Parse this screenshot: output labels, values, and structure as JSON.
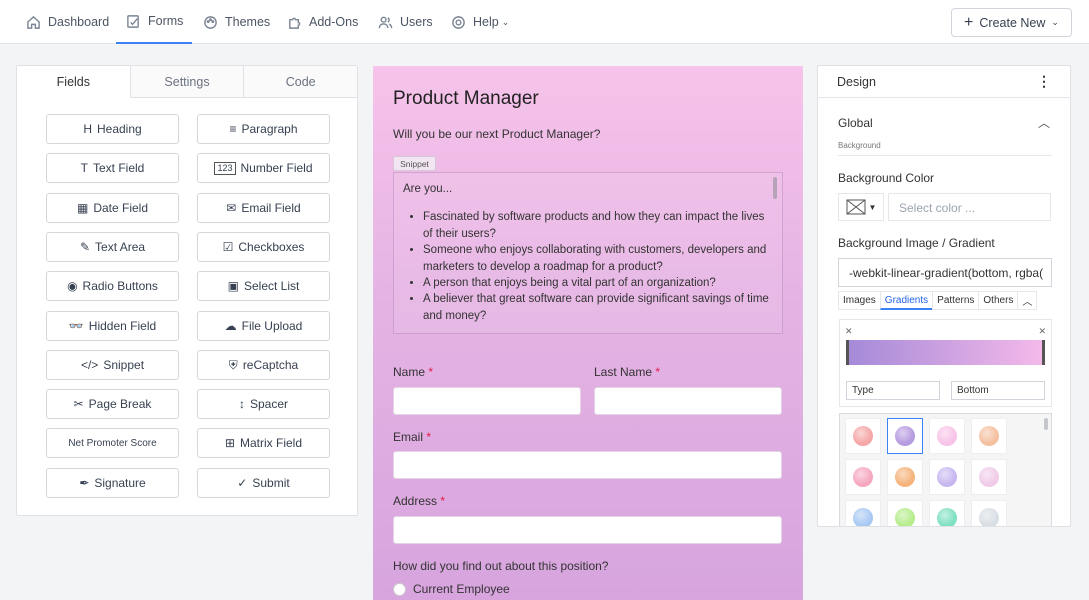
{
  "nav": {
    "items": [
      {
        "label": "Dashboard",
        "icon": "home-icon"
      },
      {
        "label": "Forms",
        "icon": "forms-icon"
      },
      {
        "label": "Themes",
        "icon": "palette-icon"
      },
      {
        "label": "Add-Ons",
        "icon": "puzzle-icon"
      },
      {
        "label": "Users",
        "icon": "users-icon"
      },
      {
        "label": "Help",
        "icon": "help-icon"
      }
    ],
    "create_label": "Create New"
  },
  "fields_panel": {
    "tabs": [
      "Fields",
      "Settings",
      "Code"
    ],
    "buttons": [
      {
        "label": "Heading",
        "icon": "H"
      },
      {
        "label": "Paragraph",
        "icon": "≡"
      },
      {
        "label": "Text Field",
        "icon": "T"
      },
      {
        "label": "Number Field",
        "icon": "123"
      },
      {
        "label": "Date Field",
        "icon": "▦"
      },
      {
        "label": "Email Field",
        "icon": "✉"
      },
      {
        "label": "Text Area",
        "icon": "✎"
      },
      {
        "label": "Checkboxes",
        "icon": "☑"
      },
      {
        "label": "Radio Buttons",
        "icon": "◉"
      },
      {
        "label": "Select List",
        "icon": "▣"
      },
      {
        "label": "Hidden Field",
        "icon": "👓"
      },
      {
        "label": "File Upload",
        "icon": "☁"
      },
      {
        "label": "Snippet",
        "icon": "</>"
      },
      {
        "label": "reCaptcha",
        "icon": "⛨"
      },
      {
        "label": "Page Break",
        "icon": "✂"
      },
      {
        "label": "Spacer",
        "icon": "↕"
      },
      {
        "label": "Net Promoter Score",
        "icon": ""
      },
      {
        "label": "Matrix Field",
        "icon": "⊞"
      },
      {
        "label": "Signature",
        "icon": "✒"
      },
      {
        "label": "Submit",
        "icon": "✓"
      }
    ]
  },
  "form": {
    "title": "Product Manager",
    "subtitle": "Will you be our next Product Manager?",
    "snippet_tag": "Snippet",
    "snippet_intro": "Are you...",
    "snippet_items": [
      "Fascinated by software products and how they can impact the lives of their users?",
      "Someone who enjoys collaborating with customers, developers and marketers to develop a roadmap for a product?",
      "A person that enjoys being a vital part of an organization?",
      "A believer that great software can provide significant savings of time and money?"
    ],
    "name_label": "Name",
    "lastname_label": "Last Name",
    "email_label": "Email",
    "address_label": "Address",
    "required_mark": "*",
    "question": "How did you find out about this position?",
    "radio_option": "Current Employee"
  },
  "design": {
    "title": "Design",
    "menu_icon": "⋮",
    "section": "Global",
    "breadcrumb": "Background",
    "bg_color_label": "Background Color",
    "color_placeholder": "Select color ...",
    "bg_image_label": "Background Image / Gradient",
    "gradient_value": "-webkit-linear-gradient(bottom, rgba(",
    "sub_tabs": [
      "Images",
      "Gradients",
      "Patterns",
      "Others"
    ],
    "active_sub_tab": "Gradients",
    "grad_type": "Type",
    "grad_direction": "Bottom",
    "swatch_colors": [
      [
        "#f5a6a6",
        "#b69be0",
        "#f8c3e8",
        "#f5c0a0"
      ],
      [
        "#f6a7c0",
        "#f5b27a",
        "#c7b7f0",
        "#f0cbe8"
      ],
      [
        "#a8c8f4",
        "#b5ec8c",
        "#7ee0c2",
        "#d7dee4"
      ]
    ]
  }
}
